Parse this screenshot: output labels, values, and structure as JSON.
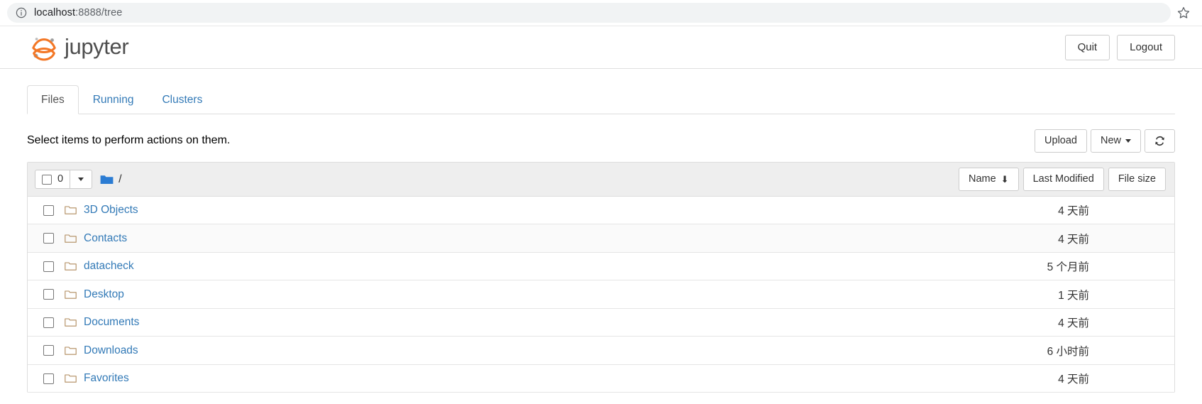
{
  "browser": {
    "info_icon": "info-circle-icon",
    "url_host": "localhost",
    "url_rest": ":8888/tree",
    "url_full": "localhost:8888/tree",
    "bookmark_icon": "star-outline-icon"
  },
  "header": {
    "logo_icon": "jupyter-logo-icon",
    "logo_text": "jupyter",
    "quit_label": "Quit",
    "logout_label": "Logout"
  },
  "tabs": [
    {
      "label": "Files",
      "active": true
    },
    {
      "label": "Running",
      "active": false
    },
    {
      "label": "Clusters",
      "active": false
    }
  ],
  "toolbar": {
    "message": "Select items to perform actions on them.",
    "upload_label": "Upload",
    "new_label": "New",
    "new_caret_icon": "chevron-down-icon",
    "refresh_icon": "refresh-icon"
  },
  "filelist": {
    "select_all_count": "0",
    "select_all_caret_icon": "chevron-down-icon",
    "breadcrumb_folder_icon": "folder-filled-icon",
    "breadcrumb_path": "/",
    "columns": {
      "name": "Name",
      "name_sort_icon": "⬇",
      "last_modified": "Last Modified",
      "file_size": "File size"
    },
    "rows": [
      {
        "icon": "folder-icon",
        "name": "3D Objects",
        "modified": "4 天前",
        "size": ""
      },
      {
        "icon": "folder-icon",
        "name": "Contacts",
        "modified": "4 天前",
        "size": ""
      },
      {
        "icon": "folder-icon",
        "name": "datacheck",
        "modified": "5 个月前",
        "size": ""
      },
      {
        "icon": "folder-icon",
        "name": "Desktop",
        "modified": "1 天前",
        "size": ""
      },
      {
        "icon": "folder-icon",
        "name": "Documents",
        "modified": "4 天前",
        "size": ""
      },
      {
        "icon": "folder-icon",
        "name": "Downloads",
        "modified": "6 小时前",
        "size": ""
      },
      {
        "icon": "folder-icon",
        "name": "Favorites",
        "modified": "4 天前",
        "size": ""
      }
    ]
  },
  "colors": {
    "link": "#337ab7",
    "jupyter_orange": "#f37726",
    "jupyter_gray": "#4e4e4e",
    "folder_blue": "#2b7cd3",
    "header_bg": "#eeeeee"
  }
}
